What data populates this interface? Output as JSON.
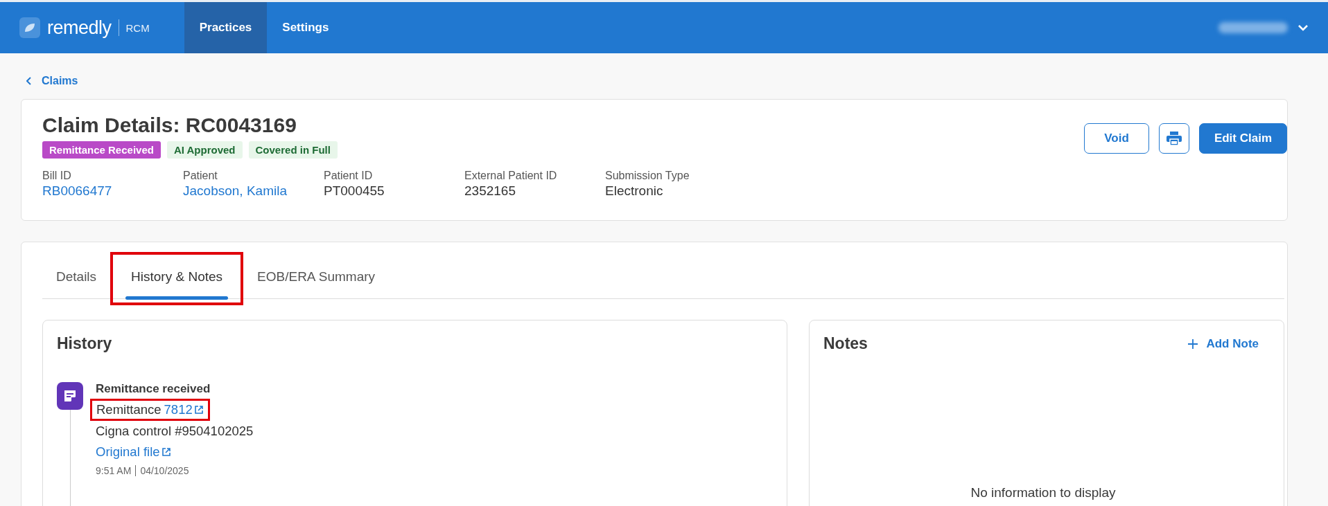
{
  "header": {
    "logo": {
      "name": "remedly",
      "product": "RCM"
    },
    "nav": [
      {
        "label": "Practices",
        "selected": true
      },
      {
        "label": "Settings",
        "selected": false
      }
    ],
    "user": {
      "blurred": true
    }
  },
  "breadcrumb": {
    "label": "Claims"
  },
  "claim": {
    "title": "Claim Details: RC0043169",
    "badges": [
      {
        "label": "Remittance Received",
        "color": "#b94ac7"
      },
      {
        "label": "AI Approved",
        "color": "#e8f6ea"
      },
      {
        "label": "Covered in Full",
        "color": "#e8f6ea"
      }
    ],
    "fields": [
      {
        "label": "Bill ID",
        "value": "RB0066477",
        "kind": "link"
      },
      {
        "label": "Patient",
        "value": "Jacobson, Kamila",
        "kind": "link"
      },
      {
        "label": "Patient ID",
        "value": "PT000455",
        "kind": "text"
      },
      {
        "label": "External Patient ID",
        "value": "2352165",
        "kind": "text"
      },
      {
        "label": "Submission Type",
        "value": "Electronic",
        "kind": "text"
      }
    ],
    "buttons": [
      {
        "label": "Void",
        "kind": "outline"
      },
      {
        "kind": "print"
      },
      {
        "label": "Edit Claim",
        "kind": "primary"
      }
    ]
  },
  "tabs": [
    {
      "label": "Details",
      "selected": false,
      "highlighted": false
    },
    {
      "label": "History & Notes",
      "selected": true,
      "highlighted": true
    },
    {
      "label": "EOB/ERA Summary",
      "selected": false,
      "highlighted": false
    }
  ],
  "history": {
    "title": "History",
    "events": [
      {
        "title": "Remittance received",
        "remittance_label": "Remittance",
        "remittance_link": "7812",
        "highlighted": true,
        "control": "Cigna control #9504102025",
        "file_link": "Original file",
        "time": "9:51 AM",
        "date": "04/10/2025"
      }
    ]
  },
  "notes": {
    "title": "Notes",
    "add_label": "Add Note",
    "empty": "No information to display"
  }
}
